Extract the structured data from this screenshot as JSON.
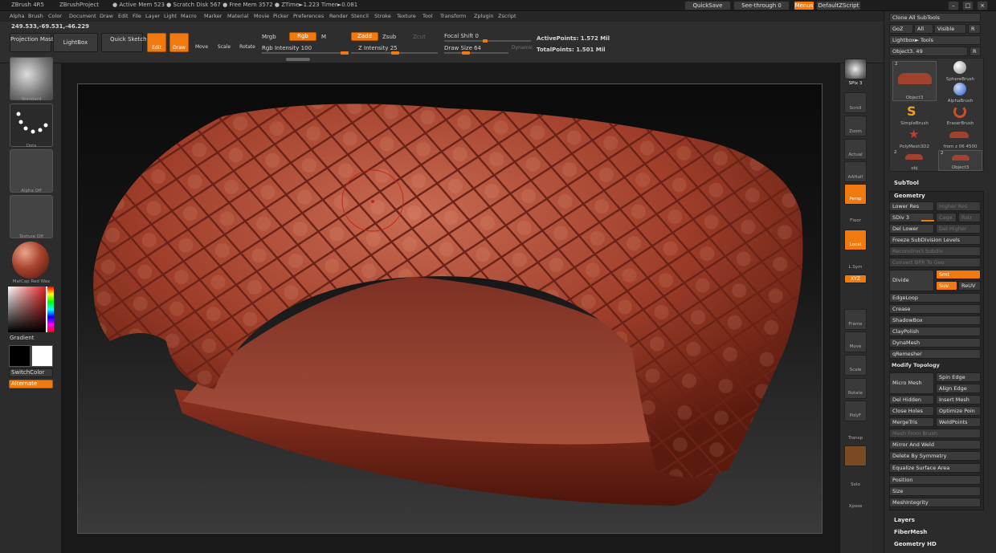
{
  "titlebar": {
    "app": "ZBrush 4R5",
    "project": "ZBrushProject",
    "stats": "● Active Mem 523 ● Scratch Disk 567 ● Free Mem 3572 ● ZTime►1.223 Timer►0.081",
    "quicksave": "QuickSave",
    "see_through": "See-through  0",
    "menus": "Menus",
    "default_zscript": "DefaultZScript"
  },
  "menubar": [
    "Alpha",
    "Brush",
    "Color",
    "Document",
    "Draw",
    "Edit",
    "File",
    "Layer",
    "Light",
    "Macro",
    "Marker",
    "Material",
    "Movie",
    "Picker",
    "Preferences",
    "Render",
    "Stencil",
    "Stroke",
    "Texture",
    "Tool",
    "Transform",
    "Zplugin",
    "Zscript"
  ],
  "toolbar": {
    "coords": "249.533,-69.531,-46.229",
    "projection_master": "Projection Master",
    "lightbox": "LightBox",
    "quick_sketch": "Quick Sketch",
    "edit": "Edit",
    "draw": "Draw",
    "move": "Move",
    "scale": "Scale",
    "rotate": "Rotate",
    "mrgb": "Mrgb",
    "rgb": "Rgb",
    "m": "M",
    "rgb_intensity": "Rgb Intensity 100",
    "zadd": "Zadd",
    "zsub": "Zsub",
    "zcut": "Zcut",
    "z_intensity": "Z Intensity 25",
    "focal_shift": "Focal Shift 0",
    "draw_size": "Draw Size 64",
    "dynamic": "Dynamic",
    "active_points": "ActivePoints: 1.572 Mil",
    "total_points": "TotalPoints: 1.501 Mil",
    "rgb_intensity_value": 100,
    "z_intensity_value": 25,
    "draw_size_value": 64
  },
  "leftshelf": {
    "brush": "Standard",
    "stroke": "Dots",
    "alpha": "Alpha Off",
    "texture": "Texture Off",
    "material": "MatCap Red Wax",
    "gradient": "Gradient",
    "switch_color": "SwitchColor",
    "alternate": "Alternate"
  },
  "rightshelf": [
    {
      "name": "bpr",
      "label": "BPR"
    },
    {
      "name": "spix",
      "label": "SPix 3"
    },
    {
      "name": "scroll",
      "label": "Scroll"
    },
    {
      "name": "zoom",
      "label": "Zoom"
    },
    {
      "name": "actual",
      "label": "Actual"
    },
    {
      "name": "aahalf",
      "label": "AAHalf"
    },
    {
      "name": "persp",
      "label": "Persp"
    },
    {
      "name": "floor",
      "label": "Floor"
    },
    {
      "name": "local",
      "label": "Local"
    },
    {
      "name": "lsym",
      "label": "L.Sym"
    },
    {
      "name": "xyz",
      "label": "XYZ"
    },
    {
      "name": "frame",
      "label": "Frame"
    },
    {
      "name": "move",
      "label": "Move"
    },
    {
      "name": "scale",
      "label": "Scale"
    },
    {
      "name": "rotate",
      "label": "Rotate"
    },
    {
      "name": "polyf",
      "label": "PolyF"
    },
    {
      "name": "transp",
      "label": "Transp"
    },
    {
      "name": "solo",
      "label": "Solo"
    },
    {
      "name": "xpose",
      "label": "Xpose"
    }
  ],
  "rightpanel": {
    "clone_all": "Clone All SubTools",
    "goz": "GoZ",
    "all": "All",
    "visible": "Visible",
    "r": "R",
    "lightbox_tools": "Lightbox► Tools",
    "object_slider": "Object3. 49",
    "tools": [
      {
        "name": "Object3",
        "count": "2"
      },
      {
        "name": "SphereBrush",
        "count": ""
      },
      {
        "name": "AlphaBrush",
        "count": ""
      },
      {
        "name": "SimpleBrush",
        "count": ""
      },
      {
        "name": "EraserBrush",
        "count": ""
      },
      {
        "name": "PolyMesh3D2",
        "count": ""
      },
      {
        "name": "from z 06 4500",
        "count": ""
      },
      {
        "name": "obj",
        "count": "2"
      },
      {
        "name": "Object3",
        "count": "2"
      }
    ],
    "subtool": "SubTool",
    "geometry": "Geometry",
    "lower_res": "Lower Res",
    "higher_res": "Higher Res",
    "sdiv": "SDiv 3",
    "cage": "Cage",
    "rstr": "Rstr",
    "del_lower": "Del Lower",
    "del_higher": "Del Higher",
    "freeze": "Freeze SubDivision Levels",
    "reconstruct": "Reconstruct Subdiv",
    "convert_bpr": "Convert BPR To Geo",
    "divide": "Divide",
    "smt": "Smt",
    "suv": "Suv",
    "reuv": "ReUV",
    "edgeloop": "EdgeLoop",
    "crease": "Crease",
    "shadowbox": "ShadowBox",
    "claypolish": "ClayPolish",
    "dynamesh": "DynaMesh",
    "qremesher": "qRemesher",
    "modify_topology": "Modify Topology",
    "spin_edge": "Spin Edge",
    "micro_mesh": "Micro Mesh",
    "align_edge": "Align Edge",
    "del_hidden": "Del Hidden",
    "insert_mesh": "Insert Mesh",
    "close_holes": "Close Holes",
    "optimize_points": "Optimize Poin",
    "mergetris": "MergeTris",
    "weldpoints": "WeldPoints",
    "mesh_from_brush": "Mesh From Brush",
    "mirror_weld": "Mirror And Weld",
    "delete_symmetry": "Delete By Symmetry",
    "equalize": "Equalize Surface Area",
    "position": "Position",
    "size": "Size",
    "meshintegrity": "MeshIntegrity",
    "layers": "Layers",
    "fibermesh": "FiberMesh",
    "geometry_hd": "Geometry HD",
    "sdiv_value": 3
  },
  "colors": {
    "accent": "#f07a10",
    "model": "#a0422e",
    "bg": "#2b2b2b"
  }
}
